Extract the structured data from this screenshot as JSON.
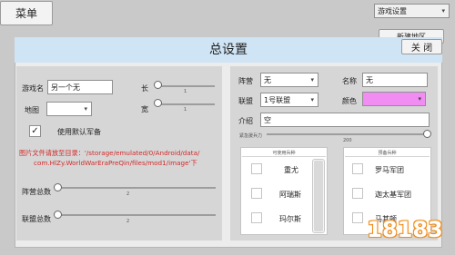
{
  "menu_button": "菜单",
  "top_right": {
    "game_settings": "游戏设置",
    "new_map": "新建地区"
  },
  "dialog": {
    "title": "总设置",
    "close_label": "关 闭",
    "left": {
      "game_name_label": "游戏名",
      "game_name_value": "另一个无",
      "map_label": "地图",
      "map_value": "",
      "length_label": "长",
      "length_value": "1",
      "width_label": "宽",
      "width_value": "1",
      "default_army_label": "使用默认军备",
      "default_army_checked": true,
      "image_note_line1": "图片文件请放至目录：'/storage/emulated/0/Android/data/",
      "image_note_line2": "com.HlZy.WorldWarEraPreQin/files/mod1/image'下",
      "camp_total_label": "阵营总数",
      "camp_total_value": "2",
      "alliance_total_label": "联盟总数",
      "alliance_total_value": "2"
    },
    "right": {
      "camp_label": "阵营",
      "camp_value": "无",
      "alliance_label": "联盟",
      "alliance_value": "1号联盟",
      "name_label": "名称",
      "name_value": "无",
      "color_label": "颜色",
      "color_value": "#f08cf2",
      "intro_label": "介绍",
      "intro_value": "空",
      "troop_power_label": "紧急援兵力",
      "troop_power_value": "200",
      "unit_panel_title": "可使用兵种",
      "units": [
        "重尤",
        "阿瑞斯",
        "玛尔斯"
      ],
      "reserve_panel_title": "预备兵种",
      "reserve_units": [
        "罗马军团",
        "迦太基军团",
        "马其顿"
      ]
    }
  },
  "watermark": "18183"
}
